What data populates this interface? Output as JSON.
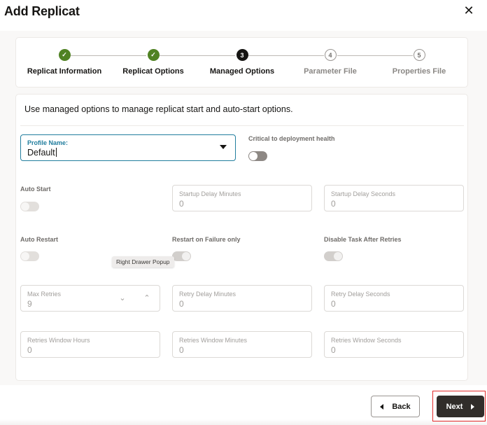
{
  "dialog": {
    "title": "Add Replicat",
    "close_icon": "close-icon"
  },
  "train": {
    "steps": [
      {
        "label": "Replicat Information",
        "state": "done",
        "marker": "✓"
      },
      {
        "label": "Replicat Options",
        "state": "done",
        "marker": "✓"
      },
      {
        "label": "Managed Options",
        "state": "current",
        "marker": "3"
      },
      {
        "label": "Parameter File",
        "state": "todo",
        "marker": "4"
      },
      {
        "label": "Properties File",
        "state": "todo",
        "marker": "5"
      }
    ]
  },
  "form": {
    "intro": "Use managed options to manage replicat start and auto-start options.",
    "profile": {
      "label": "Profile Name:",
      "value": "Default"
    },
    "critical": {
      "label": "Critical to deployment health",
      "on": false
    },
    "auto_start": {
      "label": "Auto Start",
      "on": false
    },
    "startup_delay_minutes": {
      "label": "Startup Delay Minutes",
      "value": "0"
    },
    "startup_delay_seconds": {
      "label": "Startup Delay Seconds",
      "value": "0"
    },
    "auto_restart": {
      "label": "Auto Restart",
      "on": false
    },
    "restart_on_failure": {
      "label": "Restart on Failure only",
      "on": true
    },
    "disable_task": {
      "label": "Disable Task After Retries",
      "on": true
    },
    "tooltip": "Right Drawer Popup",
    "max_retries": {
      "label": "Max Retries",
      "value": "9"
    },
    "retry_delay_minutes": {
      "label": "Retry Delay Minutes",
      "value": "0"
    },
    "retry_delay_seconds": {
      "label": "Retry Delay Seconds",
      "value": "0"
    },
    "retries_window_hours": {
      "label": "Retries Window Hours",
      "value": "0"
    },
    "retries_window_minutes": {
      "label": "Retries Window Minutes",
      "value": "0"
    },
    "retries_window_seconds": {
      "label": "Retries Window Seconds",
      "value": "0"
    }
  },
  "footer": {
    "back_label": "Back",
    "next_label": "Next"
  },
  "colors": {
    "done": "#508223",
    "current": "#161513",
    "accent": "#227e9e",
    "primary_button": "#312d2a",
    "highlight": "#e32b2b"
  }
}
